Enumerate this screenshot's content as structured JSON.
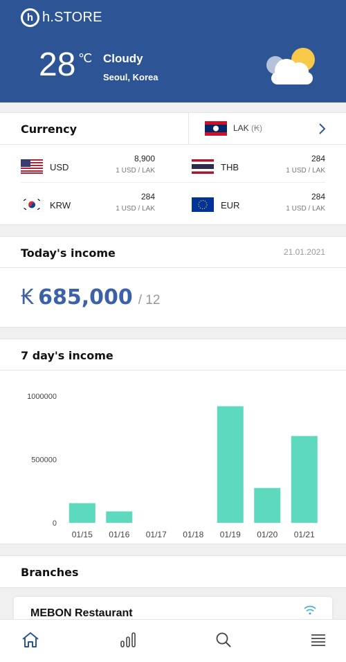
{
  "app": {
    "logo_letter": "h",
    "logo_text": "h.STORE"
  },
  "weather": {
    "temp": "28",
    "unit": "℃",
    "condition": "Cloudy",
    "city": "Seoul, Korea",
    "icon": "partly-cloudy-icon"
  },
  "currency": {
    "title": "Currency",
    "base": {
      "code": "LAK",
      "symbol": "(₭)"
    },
    "rates": [
      {
        "code": "USD",
        "value": "8,900",
        "unit": "1 USD / LAK"
      },
      {
        "code": "THB",
        "value": "284",
        "unit": "1 USD / LAK"
      },
      {
        "code": "KRW",
        "value": "284",
        "unit": "1 USD / LAK"
      },
      {
        "code": "EUR",
        "value": "284",
        "unit": "1 USD / LAK"
      }
    ]
  },
  "income": {
    "title": "Today's income",
    "date": "21.01.2021",
    "symbol": "₭",
    "amount": "685,000",
    "count": "/ 12"
  },
  "weekly": {
    "title": "7 day's income"
  },
  "chart_data": {
    "type": "bar",
    "categories": [
      "01/15",
      "01/16",
      "01/17",
      "01/18",
      "01/19",
      "01/20",
      "01/21"
    ],
    "values": [
      155000,
      90000,
      0,
      0,
      920000,
      275000,
      685000
    ],
    "yticks": [
      0,
      500000,
      1000000
    ],
    "ylim": [
      0,
      1000000
    ],
    "color": "#5dd9bd",
    "grid": false
  },
  "branches": {
    "title": "Branches",
    "items": [
      {
        "name": "MEBON Restaurant",
        "status_icon": "wifi-icon"
      }
    ]
  },
  "nav": [
    {
      "name": "home-icon"
    },
    {
      "name": "stats-icon"
    },
    {
      "name": "search-icon"
    },
    {
      "name": "menu-icon"
    }
  ],
  "colors": {
    "header": "#2d5494",
    "accent": "#3d61a8",
    "bar": "#5dd9bd"
  }
}
